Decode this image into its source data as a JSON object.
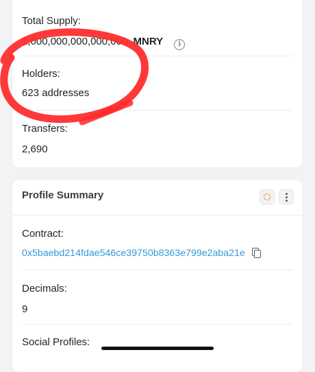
{
  "overview": {
    "total_supply": {
      "label": "Total Supply:",
      "amount": "1,000,000,000,000,000",
      "symbol": "MNRY",
      "info_icon": "info-circle-icon"
    },
    "holders": {
      "label": "Holders:",
      "value": "623 addresses"
    },
    "transfers": {
      "label": "Transfers:",
      "value": "2,690"
    }
  },
  "profile_summary": {
    "title": "Profile Summary",
    "status_icon": "circle-icon",
    "menu_icon": "more-vertical-icon",
    "contract": {
      "label": "Contract:",
      "address": "0x5baebd214fdae546ce39750b8363e799e2aba21e",
      "copy_icon": "copy-icon"
    },
    "decimals": {
      "label": "Decimals:",
      "value": "9"
    },
    "social_profiles": {
      "label": "Social Profiles:"
    }
  },
  "colors": {
    "page_background": "#f1f3f5",
    "card_background": "#ffffff",
    "link": "#3498db",
    "status_circle": "#e0a82e",
    "annotation_marker": "#ff2a2a"
  }
}
